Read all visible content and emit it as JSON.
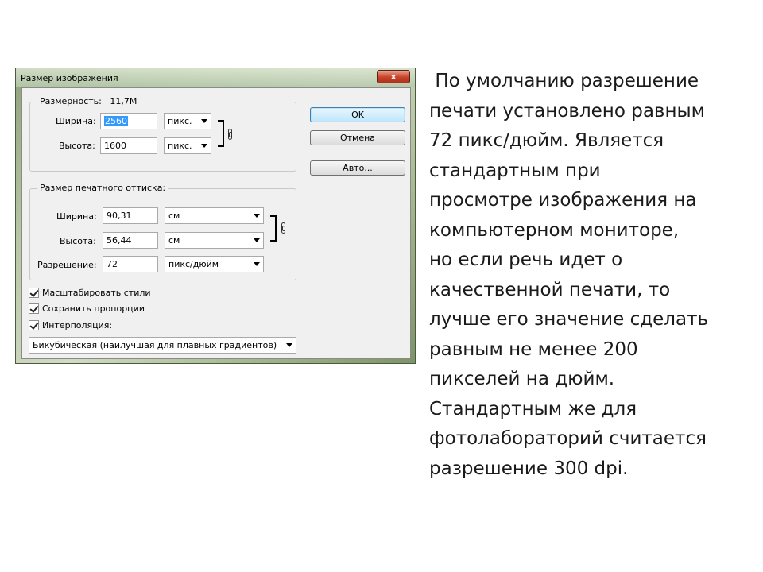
{
  "dialog": {
    "title": "Размер изображения",
    "close_label": "x",
    "pixel_group": {
      "title_label": "Размерность:",
      "title_value": "11,7M",
      "width_label": "Ширина:",
      "width_value": "2560",
      "width_unit": "пикс.",
      "height_label": "Высота:",
      "height_value": "1600",
      "height_unit": "пикс."
    },
    "print_group": {
      "title": "Размер печатного оттиска:",
      "width_label": "Ширина:",
      "width_value": "90,31",
      "width_unit": "см",
      "height_label": "Высота:",
      "height_value": "56,44",
      "height_unit": "см",
      "resolution_label": "Разрешение:",
      "resolution_value": "72",
      "resolution_unit": "пикс/дюйм"
    },
    "buttons": {
      "ok": "OK",
      "cancel": "Отмена",
      "auto": "Авто..."
    },
    "checkboxes": {
      "scale_styles": "Масштабировать стили",
      "constrain": "Сохранить пропорции",
      "resample": "Интерполяция:"
    },
    "resample_method": "Бикубическая (наилучшая для плавных градиентов)"
  },
  "explanation": " По умолчанию разрешение печати установлено равным 72 пикс/дюйм. Является стандартным при просмотре изображения на компьютерном мониторе, но если речь идет о качественной печати, то лучше его значение сделать равным не менее 200 пикселей на дюйм. Стандартным же для фотолабораторий считается разрешение 300 dpi.",
  "explanation_lines": [
    " По умолчанию разрешение",
    "печати установлено равным",
    "72 пикс/дюйм. Является",
    "стандартным при",
    "просмотре изображения на",
    "компьютерном мониторе,",
    "но если речь идет о",
    "качественной печати, то",
    "лучше его значение сделать",
    "равным не менее 200",
    "пикселей на дюйм.",
    "Стандартным же для",
    "фотолабораторий считается",
    "разрешение 300 dpi."
  ]
}
